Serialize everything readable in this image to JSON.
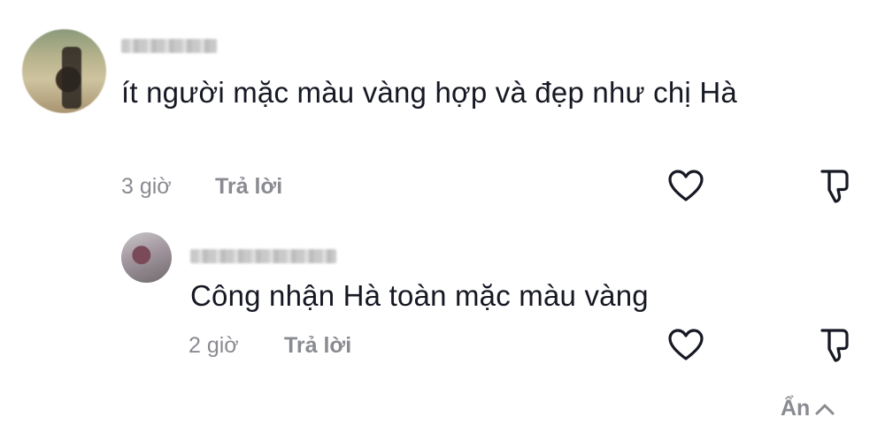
{
  "comment": {
    "text": "ít người mặc màu vàng hợp và đẹp như chị Hà",
    "time": "3 giờ",
    "reply_label": "Trả lời"
  },
  "reply": {
    "text": "Công nhận Hà toàn mặc màu vàng",
    "time": "2 giờ",
    "reply_label": "Trả lời"
  },
  "hide_toggle": {
    "label": "Ẩn",
    "icon": "chevron-up-icon"
  },
  "icons": {
    "like": "heart-outline-icon",
    "dislike": "thumbs-down-icon"
  },
  "colors": {
    "text": "#161823",
    "meta": "#8a8b91",
    "background": "#ffffff"
  }
}
